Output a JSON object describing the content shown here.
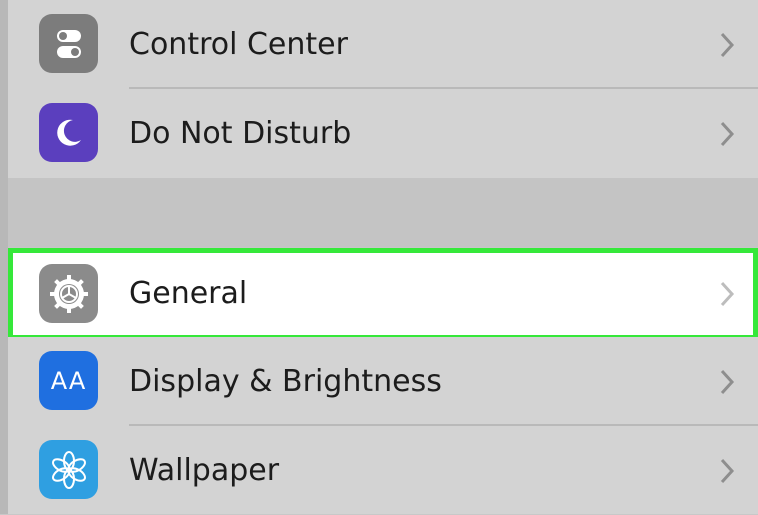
{
  "colors": {
    "highlight": "#35e83a",
    "control_center_icon_bg": "#7c7c7c",
    "dnd_icon_bg": "#5b3fbe",
    "general_icon_bg": "#8b8b8b",
    "display_icon_bg": "#1f6fe0",
    "wallpaper_icon_bg": "#2f9fe1"
  },
  "settings": {
    "items": [
      {
        "label": "Control Center",
        "icon": "control-center-icon"
      },
      {
        "label": "Do Not Disturb",
        "icon": "moon-icon"
      },
      {
        "label": "General",
        "icon": "gear-icon",
        "selected": true
      },
      {
        "label": "Display & Brightness",
        "icon": "text-size-icon",
        "icon_text": "AA"
      },
      {
        "label": "Wallpaper",
        "icon": "flower-icon"
      }
    ]
  }
}
